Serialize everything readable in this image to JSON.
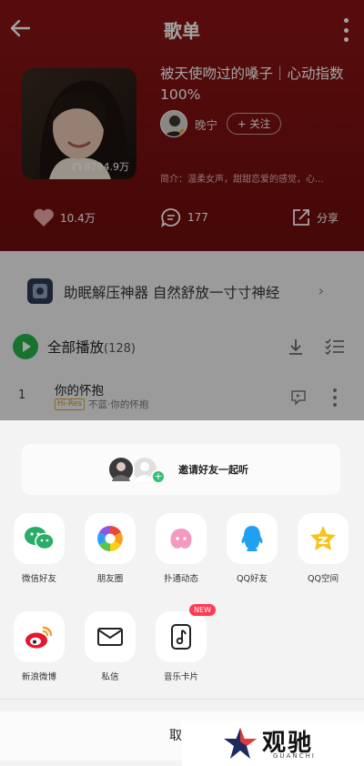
{
  "header": {
    "title": "歌单",
    "playlist_title": "被天使吻过的嗓子｜心动指数100%",
    "play_count": "8794.9万",
    "creator_name": "晚宁",
    "follow_label": "+ 关注",
    "intro": "简介：温柔女声，甜甜恋爱的感觉，心..."
  },
  "actions": {
    "likes": "10.4万",
    "comments": "177",
    "share": "分享"
  },
  "promo": {
    "text": "助眠解压神器 自然舒放一寸寸神经"
  },
  "play_all": {
    "label": "全部播放",
    "count": "(128)"
  },
  "songs": [
    {
      "index": "1",
      "title": "你的怀抱",
      "badge": "Hi-Res",
      "subtitle": "不蓝·你的怀抱"
    }
  ],
  "share_sheet": {
    "invite_text": "邀请好友一起听",
    "row1": [
      {
        "label": "微信好友",
        "icon": "wechat-icon"
      },
      {
        "label": "朋友圈",
        "icon": "moments-icon"
      },
      {
        "label": "扑通动态",
        "icon": "putong-icon"
      },
      {
        "label": "QQ好友",
        "icon": "qq-icon"
      },
      {
        "label": "QQ空间",
        "icon": "qzone-icon"
      }
    ],
    "row2": [
      {
        "label": "新浪微博",
        "icon": "weibo-icon"
      },
      {
        "label": "私信",
        "icon": "mail-icon"
      },
      {
        "label": "音乐卡片",
        "icon": "music-card-icon",
        "badge": "NEW"
      }
    ],
    "cancel_label": "取"
  },
  "watermark": {
    "text": "观驰",
    "sub": "GUANCHI"
  },
  "colors": {
    "header_red": "#7a1010",
    "play_green": "#27b24a",
    "new_badge": "#ff3b53"
  }
}
